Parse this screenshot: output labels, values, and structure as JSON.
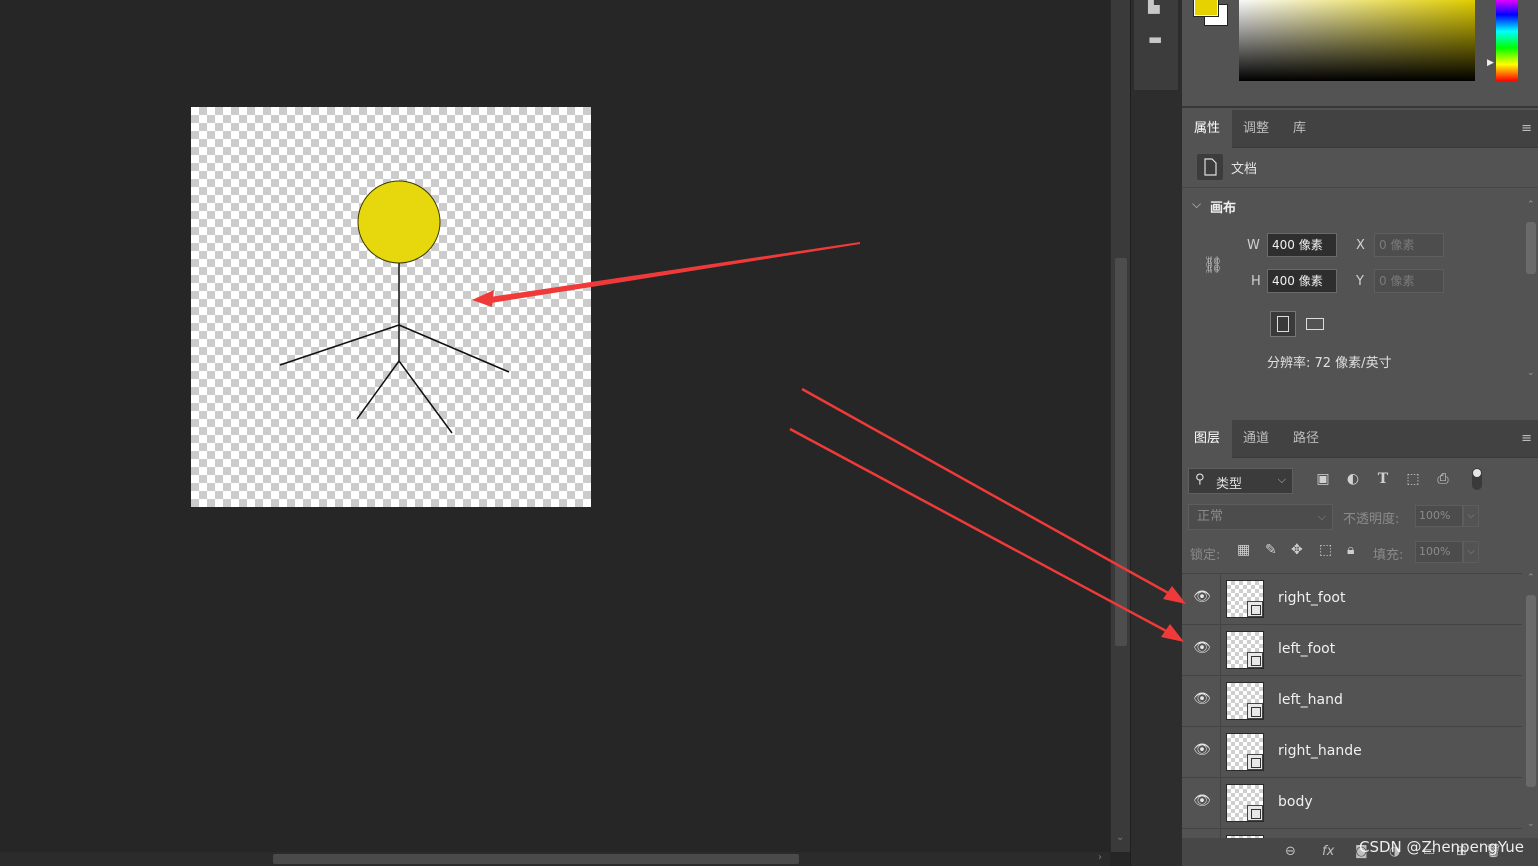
{
  "properties": {
    "tabs": [
      "属性",
      "调整",
      "库"
    ],
    "active_tab": "属性",
    "doc_label": "文档",
    "canvas_section_title": "画布",
    "width_label": "W",
    "width_value": "400 像素",
    "height_label": "H",
    "height_value": "400 像素",
    "x_label": "X",
    "x_placeholder": "0 像素",
    "y_label": "Y",
    "y_placeholder": "0 像素",
    "resolution": "分辨率: 72 像素/英寸"
  },
  "layers_panel": {
    "tabs": [
      "图层",
      "通道",
      "路径"
    ],
    "active_tab": "图层",
    "filter_label": "类型",
    "blend_mode": "正常",
    "opacity_label": "不透明度:",
    "opacity_value": "100%",
    "lock_label": "锁定:",
    "fill_label": "填充:",
    "fill_value": "100%",
    "layers": [
      {
        "name": "right_foot"
      },
      {
        "name": "left_foot"
      },
      {
        "name": "left_hand"
      },
      {
        "name": "right_hande"
      },
      {
        "name": "body"
      }
    ]
  },
  "colors": {
    "foreground": "#e6d200",
    "background": "#ffffff",
    "head_fill": "#e6d80c",
    "annotation_arrow": "#f03a3a"
  },
  "watermark": "CSDN @ZhenpengYue"
}
